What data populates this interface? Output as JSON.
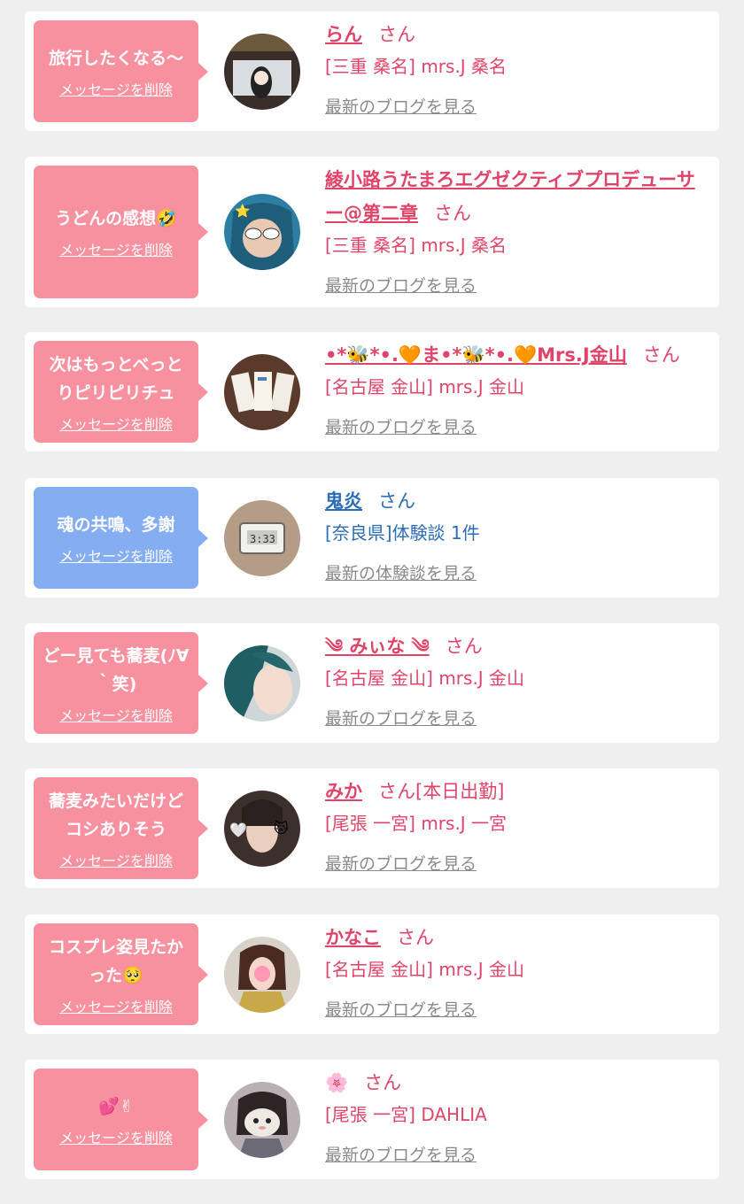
{
  "delete_label": "メッセージを削除",
  "entries": [
    {
      "message": "旅行したくなる〜",
      "name": "らん",
      "suffix": "さん",
      "shop": "[三重 桑名] mrs.J 桑名",
      "link": "最新のブログを見る",
      "color": "pink"
    },
    {
      "message": "うどんの感想🤣",
      "name": "綾小路うたまろエグゼクティブプロデューサー@第二章",
      "suffix": "さん",
      "shop": "[三重 桑名] mrs.J 桑名",
      "link": "最新のブログを見る",
      "color": "pink"
    },
    {
      "message": "次はもっとべっとりピリピリチュ",
      "name": "•*🐝*•.🧡ま•*🐝*•.🧡Mrs.J金山",
      "suffix": "さん",
      "shop": "[名古屋 金山] mrs.J 金山",
      "link": "最新のブログを見る",
      "color": "pink"
    },
    {
      "message": "魂の共鳴、多謝",
      "name": "鬼炎",
      "suffix": "さん",
      "shop": "[奈良県]体験談 1件",
      "link": "最新の体験談を見る",
      "color": "blue"
    },
    {
      "message": "どー見ても蕎麦(ﾉ∀｀笑)",
      "name": "༄ みぃな ༄",
      "suffix": "さん",
      "shop": "[名古屋 金山] mrs.J 金山",
      "link": "最新のブログを見る",
      "color": "pink"
    },
    {
      "message": "蕎麦みたいだけどコシありそう",
      "name": "みか",
      "suffix": "さん[本日出勤]",
      "shop": "[尾張 一宮] mrs.J 一宮",
      "link": "最新のブログを見る",
      "color": "pink"
    },
    {
      "message": "コスプレ姿見たかった🥺",
      "name": "かなこ",
      "suffix": "さん",
      "shop": "[名古屋 金山] mrs.J 金山",
      "link": "最新のブログを見る",
      "color": "pink"
    },
    {
      "message": "💕✌",
      "name": "🌸",
      "suffix": "さん",
      "shop": "[尾張 一宮] DAHLIA",
      "link": "最新のブログを見る",
      "color": "pink"
    }
  ],
  "colors": {
    "pink_bubble": "#f7909f",
    "blue_bubble": "#84adf2",
    "pink_text": "#e0446a",
    "blue_text": "#2c6db5",
    "link_gray": "#8a8a8a"
  },
  "avatar_icons": [
    "photo-avatar-icon"
  ]
}
